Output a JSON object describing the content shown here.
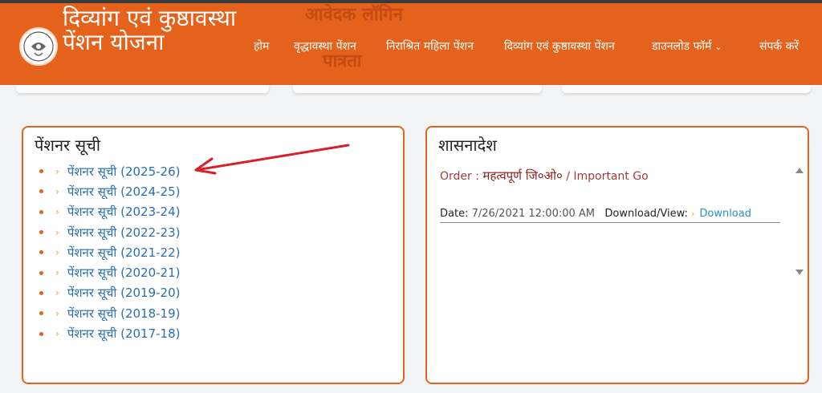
{
  "header": {
    "site_title": "दिव्यांग एवं कुष्ठावस्था पेंशन योजना",
    "ghost_text_top": "आवेदक लॉगिन",
    "ghost_text_bottom": "पात्रता",
    "logo_icon": "up-government-emblem-icon",
    "bg_color": "#e4621b"
  },
  "nav": [
    {
      "label": "होम"
    },
    {
      "label": "वृद्धावस्था पेंशन"
    },
    {
      "label": "निराश्रित महिला पेंशन"
    },
    {
      "label": "दिव्यांग एवं कुष्ठावस्था पेंशन"
    },
    {
      "label": "डाउनलोड फॉर्म",
      "chevron": "⌄"
    },
    {
      "label": "संपर्क करें"
    }
  ],
  "pensioner_panel": {
    "title": "पेंशनर सूची",
    "items": [
      {
        "label": "पेंशनर सूची",
        "year": "(2025-26)"
      },
      {
        "label": "पेंशनर सूची",
        "year": "(2024-25)"
      },
      {
        "label": "पेंशनर सूची",
        "year": "(2023-24)"
      },
      {
        "label": "पेंशनर सूची",
        "year": "(2022-23)"
      },
      {
        "label": "पेंशनर सूची",
        "year": "(2021-22)"
      },
      {
        "label": "पेंशनर सूची",
        "year": "(2020-21)"
      },
      {
        "label": "पेंशनर सूची",
        "year": "(2019-20)"
      },
      {
        "label": "पेंशनर सूची",
        "year": "(2018-19)"
      },
      {
        "label": "पेंशनर सूची",
        "year": "(2017-18)"
      }
    ],
    "bullet_chevron": "›",
    "annotation_icon": "red-arrow-pointer-icon"
  },
  "order_panel": {
    "title": "शासनादेश",
    "order_prefix": "Order : ",
    "order_hindi": "महत्वपूर्ण जि०ओ०",
    "order_english": " / Important Go",
    "date_label": "Date: ",
    "date_value": "7/26/2021 12:00:00 AM",
    "download_label": "Download/View:",
    "download_chevron": "›",
    "download_link": "Download"
  }
}
